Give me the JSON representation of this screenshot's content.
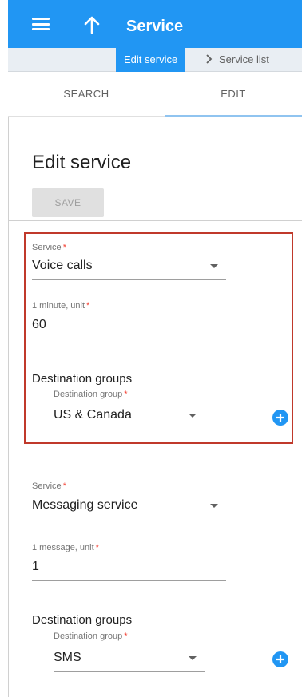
{
  "appbar": {
    "title": "Service",
    "menu_icon": "menu-icon",
    "back_icon": "arrow-up-icon",
    "color": "#2196f3"
  },
  "breadcrumb": {
    "current": "Edit service",
    "separator_icon": "chevron-right-icon",
    "parent": "Service list"
  },
  "tabs": [
    {
      "label": "SEARCH",
      "active": false
    },
    {
      "label": "EDIT",
      "active": true
    }
  ],
  "main": {
    "title": "Edit service",
    "save_label": "SAVE",
    "save_enabled": false
  },
  "services": [
    {
      "service_label": "Service",
      "service_value": "Voice calls",
      "unit_label": "1 minute, unit",
      "unit_value": "60",
      "destination_groups_title": "Destination groups",
      "destination_group_label": "Destination group",
      "destination_group_value": "US & Canada",
      "highlighted": true,
      "highlight_color": "#c0392b"
    },
    {
      "service_label": "Service",
      "service_value": "Messaging service",
      "unit_label": "1 message, unit",
      "unit_value": "1",
      "destination_groups_title": "Destination groups",
      "destination_group_label": "Destination group",
      "destination_group_value": "SMS",
      "highlighted": false
    }
  ],
  "required_marker": "*",
  "accent_color": "#2196f3",
  "required_color": "#f44336"
}
